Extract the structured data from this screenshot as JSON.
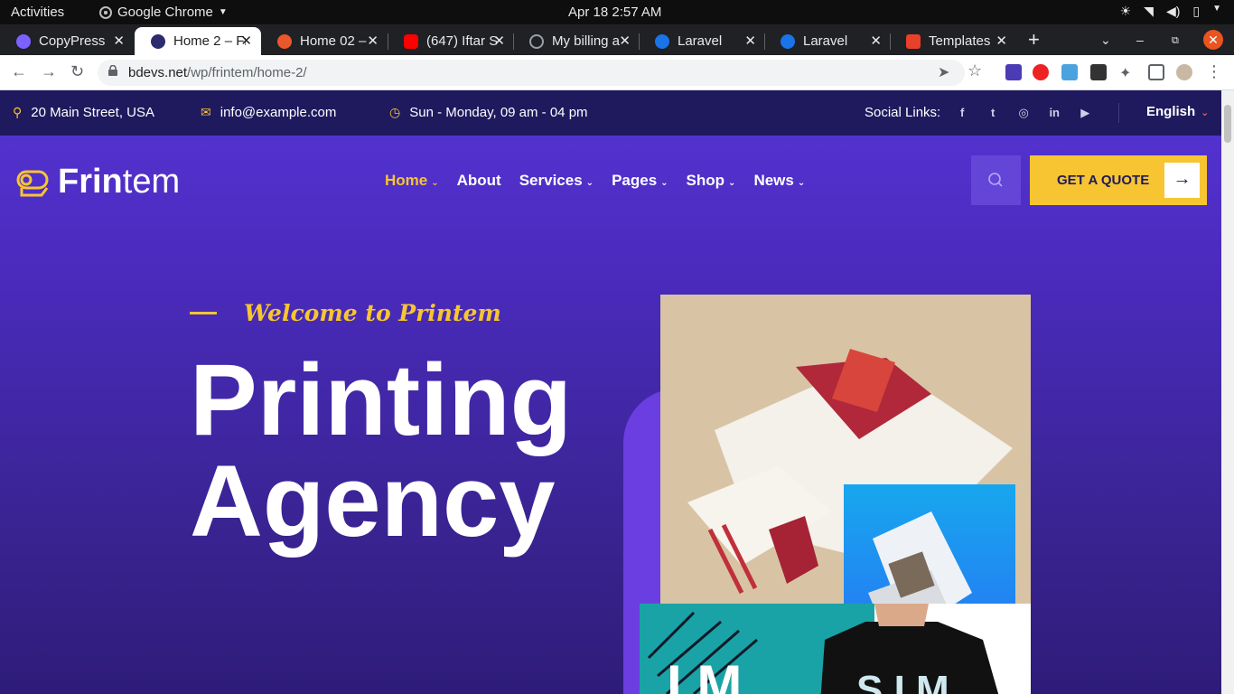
{
  "os": {
    "activities": "Activities",
    "app_name": "Google Chrome",
    "datetime": "Apr 18  2:57 AM"
  },
  "tabs": [
    {
      "title": "CopyPress",
      "favicon_color": "#7b61ff"
    },
    {
      "title": "Home 2 – Fr",
      "favicon_color": "#2b2b6e"
    },
    {
      "title": "Home 02 –",
      "favicon_color": "#e8582a"
    },
    {
      "title": "(647) Iftar S",
      "favicon_color": "#ff0000"
    },
    {
      "title": "My billing a",
      "favicon_color": "#9aa0a6"
    },
    {
      "title": "Laravel",
      "favicon_color": "#1a73e8"
    },
    {
      "title": "Laravel",
      "favicon_color": "#1a73e8"
    },
    {
      "title": "Templates",
      "favicon_color": "#e8402a"
    }
  ],
  "address": {
    "domain": "bdevs.net",
    "path": "/wp/frintem/home-2/"
  },
  "site": {
    "info": {
      "address": "20 Main Street, USA",
      "email": "info@example.com",
      "hours": "Sun - Monday, 09 am - 04 pm",
      "social_label": "Social Links:",
      "language": "English"
    },
    "logo": {
      "part1": "Frin",
      "part2": "tem"
    },
    "menu": [
      {
        "label": "Home",
        "dropdown": true,
        "active": true
      },
      {
        "label": "About",
        "dropdown": false,
        "active": false
      },
      {
        "label": "Services",
        "dropdown": true,
        "active": false
      },
      {
        "label": "Pages",
        "dropdown": true,
        "active": false
      },
      {
        "label": "Shop",
        "dropdown": true,
        "active": false
      },
      {
        "label": "News",
        "dropdown": true,
        "active": false
      }
    ],
    "quote_button": "GET A QUOTE",
    "hero": {
      "welcome": "Welcome to Printem",
      "title": "Printing Agency"
    },
    "colors": {
      "accent": "#f7c531",
      "topbar": "#1f1a5e",
      "hero": "#5534d3"
    }
  }
}
